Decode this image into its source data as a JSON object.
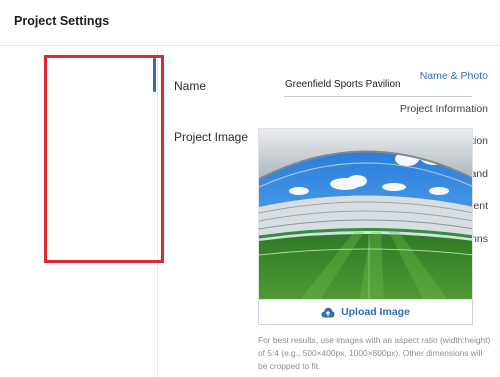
{
  "header": {
    "title": "Project Settings"
  },
  "sidebar": {
    "items": [
      {
        "label": "Name & Photo",
        "active": true
      },
      {
        "label": "Project Information",
        "active": false
      },
      {
        "label": "Location",
        "active": false
      },
      {
        "label": "Brand",
        "active": false
      },
      {
        "label": "User Management",
        "active": false
      },
      {
        "label": "Custom Columns",
        "active": false
      }
    ]
  },
  "main": {
    "name_label": "Name",
    "name_value": "Greenfield Sports Pavilion",
    "image_label": "Project Image",
    "upload_label": "Upload Image",
    "upload_icon": "cloud-upload-icon",
    "hint": "For best results, use images with an aspect ratio (width:height) of 5:4 (e.g., 500×400px, 1000×800px). Other dimensions will be cropped to fit."
  },
  "colors": {
    "accent": "#2c6fb5",
    "highlight": "#e0262e",
    "pitch": "#3d8f2e",
    "sky": "#3a8fe0"
  }
}
